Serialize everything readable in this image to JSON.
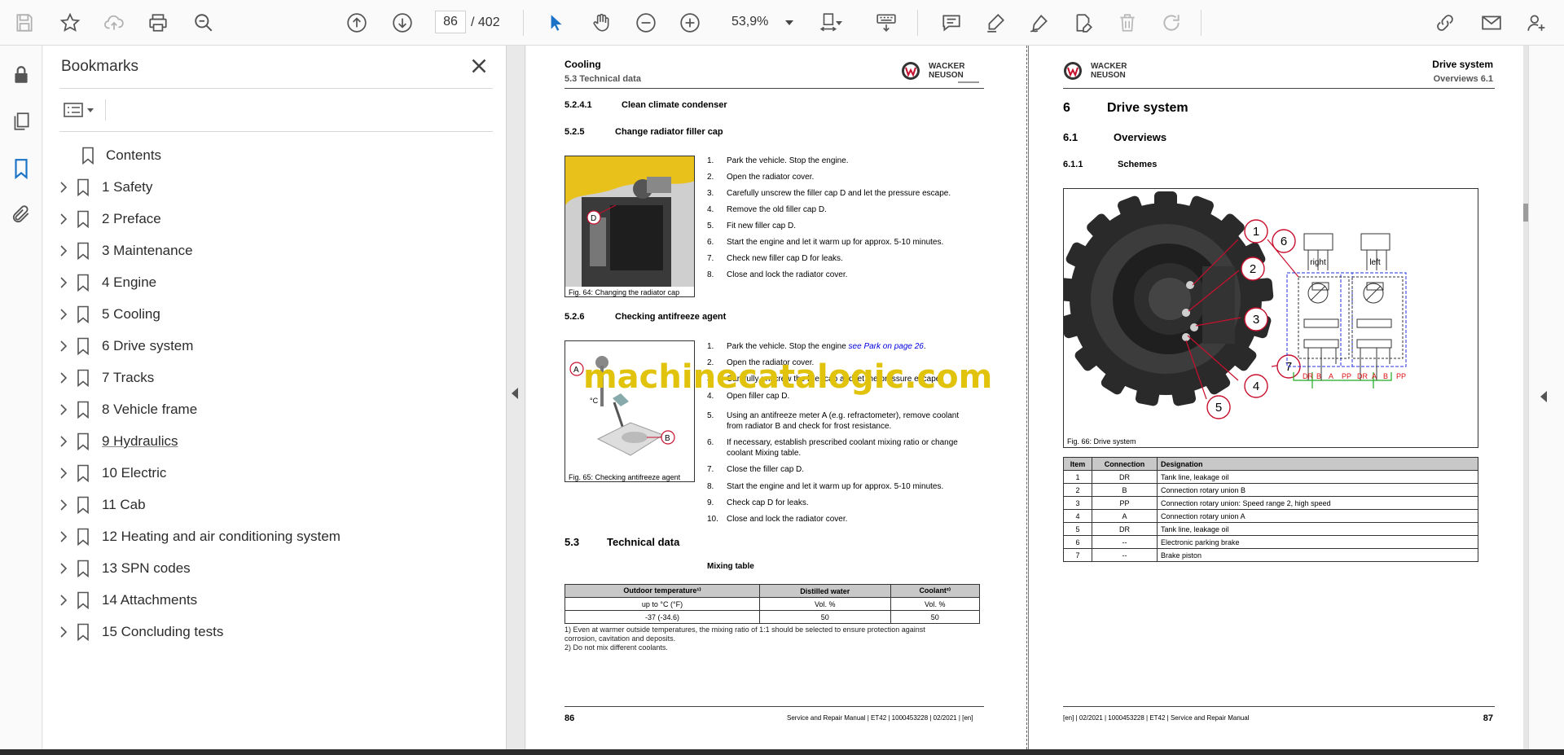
{
  "toolbar": {
    "page_current": "86",
    "page_total": "/ 402",
    "zoom": "53,9%"
  },
  "bookmarks": {
    "title": "Bookmarks",
    "items": [
      {
        "label": "Contents",
        "has_children": false
      },
      {
        "label": "1 Safety",
        "has_children": true
      },
      {
        "label": "2 Preface",
        "has_children": true
      },
      {
        "label": "3 Maintenance",
        "has_children": true
      },
      {
        "label": "4 Engine",
        "has_children": true
      },
      {
        "label": "5 Cooling",
        "has_children": true
      },
      {
        "label": "6 Drive system",
        "has_children": true
      },
      {
        "label": "7 Tracks",
        "has_children": true
      },
      {
        "label": "8 Vehicle frame",
        "has_children": true
      },
      {
        "label": "9 Hydraulics",
        "has_children": true
      },
      {
        "label": "10 Electric",
        "has_children": true
      },
      {
        "label": "11 Cab",
        "has_children": true
      },
      {
        "label": "12 Heating and air conditioning system",
        "has_children": true
      },
      {
        "label": "13 SPN codes",
        "has_children": true
      },
      {
        "label": "14 Attachments",
        "has_children": true
      },
      {
        "label": "15 Concluding tests",
        "has_children": true
      }
    ]
  },
  "watermark": "machinecatalogic.com",
  "page_left": {
    "header_title": "Cooling",
    "header_sub": "5.3 Technical data",
    "logo_text": "WACKER NEUSON",
    "s1_num": "5.2.4.1",
    "s1_title": "Clean climate condenser",
    "s2_num": "5.2.5",
    "s2_title": "Change radiator filler cap",
    "steps_a": [
      {
        "n": "1.",
        "t": "Park the vehicle. Stop the engine."
      },
      {
        "n": "2.",
        "t": "Open the radiator cover."
      },
      {
        "n": "3.",
        "t": "Carefully unscrew the filler cap D and let the pressure escape."
      },
      {
        "n": "4.",
        "t": "Remove the old filler cap D."
      },
      {
        "n": "5.",
        "t": "Fit new filler cap D."
      },
      {
        "n": "6.",
        "t": "Start the engine and let it warm up for approx. 5-10 minutes."
      },
      {
        "n": "7.",
        "t": "Check new filler cap D for leaks."
      },
      {
        "n": "8.",
        "t": "Close and lock the radiator cover."
      }
    ],
    "fig64": "Fig. 64: Changing the radiator cap",
    "s3_num": "5.2.6",
    "s3_title": "Checking antifreeze agent",
    "steps_b_1": "Park the vehicle. Stop the engine ",
    "steps_b_1_link": "see Park on page 26",
    "steps_b": [
      {
        "n": "2.",
        "t": "Open the radiator cover."
      },
      {
        "n": "3.",
        "t": "Carefully unscrew the filler cap and let the pressure escape."
      },
      {
        "n": "4.",
        "t": "Open filler cap D."
      },
      {
        "n": "5.",
        "t": "Using an antifreeze meter A (e.g. refractometer), remove coolant"
      },
      {
        "n": "",
        "t": "from radiator B and check for frost resistance."
      },
      {
        "n": "6.",
        "t": "If necessary, establish prescribed coolant mixing ratio or change"
      },
      {
        "n": "",
        "t": "coolant Mixing table."
      },
      {
        "n": "7.",
        "t": "Close the filler cap D."
      },
      {
        "n": "8.",
        "t": "Start the engine and let it warm up for approx. 5-10 minutes."
      },
      {
        "n": "9.",
        "t": "Check cap D for leaks."
      },
      {
        "n": "10.",
        "t": "Close and lock the radiator cover."
      }
    ],
    "fig65": "Fig. 65: Checking antifreeze agent",
    "fig64_label": "D",
    "fig65_label_a": "A",
    "fig65_label_b": "B",
    "fig65_label_c": "°C",
    "s4_num": "5.3",
    "s4_title": "Technical data",
    "mix_title": "Mixing table",
    "mix_headers": [
      "Outdoor temperature¹⁾",
      "Distilled water",
      "Coolant²⁾"
    ],
    "mix_rows": [
      [
        "up to °C (°F)",
        "Vol. %",
        "Vol. %"
      ],
      [
        "-37 (-34.6)",
        "50",
        "50"
      ]
    ],
    "footnote1": "1) Even at warmer outside temperatures, the mixing ratio of 1:1 should be selected to ensure protection against",
    "footnote1b": "corrosion, cavitation and deposits.",
    "footnote2": "2) Do not mix different coolants.",
    "page_no": "86",
    "footer": "Service and Repair Manual | ET42 | 1000453228 | 02/2021 | [en]"
  },
  "page_right": {
    "header_title": "Drive system",
    "header_sub": "Overviews 6.1",
    "logo_text": "WACKER NEUSON",
    "h1_num": "6",
    "h1_title": "Drive system",
    "h2_num": "6.1",
    "h2_title": "Overviews",
    "h3_num": "6.1.1",
    "h3_title": "Schemes",
    "fig66": "Fig. 66: Drive system",
    "callouts": [
      "1",
      "2",
      "3",
      "4",
      "5",
      "6",
      "7"
    ],
    "scheme_right": "right",
    "scheme_left": "left",
    "ports": [
      "DR",
      "B",
      "A",
      "PP",
      "DR",
      "A",
      "B",
      "PP"
    ],
    "legend_headers": [
      "Item",
      "Connection",
      "Designation"
    ],
    "legend_rows": [
      [
        "1",
        "DR",
        "Tank line, leakage oil"
      ],
      [
        "2",
        "B",
        "Connection rotary union B"
      ],
      [
        "3",
        "PP",
        "Connection rotary union: Speed range 2, high speed"
      ],
      [
        "4",
        "A",
        "Connection rotary union A"
      ],
      [
        "5",
        "DR",
        "Tank line, leakage oil"
      ],
      [
        "6",
        "--",
        "Electronic parking brake"
      ],
      [
        "7",
        "--",
        "Brake piston"
      ]
    ],
    "page_no": "87",
    "footer": "[en] | 02/2021 | 1000453228 | ET42 | Service and Repair Manual"
  }
}
